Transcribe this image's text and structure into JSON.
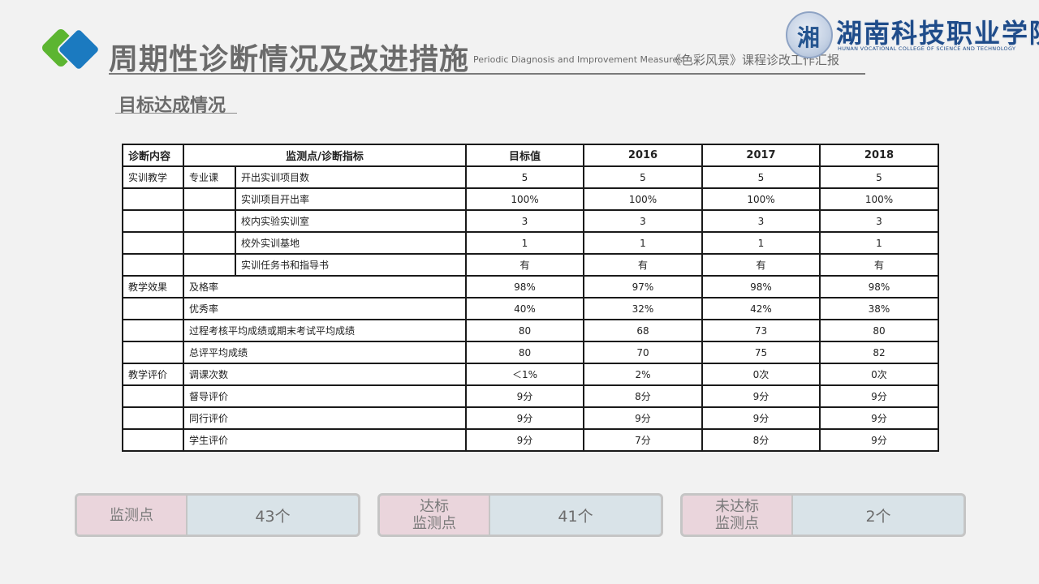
{
  "header": {
    "title": "周期性诊断情况及改进措施",
    "subtitle_en": "Periodic Diagnosis and Improvement Measures",
    "subtitle_cn": "《色彩风景》课程诊改工作汇报"
  },
  "school": {
    "name_cn": "湖南科技职业学院",
    "name_en": "HUNAN VOCATIONAL COLLEGE OF SCIENCE AND TECHNOLOGY"
  },
  "section_title": "目标达成情况",
  "table": {
    "headers": [
      "诊断内容",
      "监测点/诊断指标",
      "目标值",
      "2016",
      "2017",
      "2018"
    ],
    "rows": [
      {
        "c1": "实训教学",
        "c2": "专业课",
        "c3": "开出实训项目数",
        "vals": [
          "5",
          "5",
          "5",
          "5"
        ]
      },
      {
        "c1": "",
        "c2": "",
        "c3": "实训项目开出率",
        "vals": [
          "100%",
          "100%",
          "100%",
          "100%"
        ]
      },
      {
        "c1": "",
        "c2": "",
        "c3": "校内实验实训室",
        "vals": [
          "3",
          "3",
          "3",
          "3"
        ]
      },
      {
        "c1": "",
        "c2": "",
        "c3": "校外实训基地",
        "vals": [
          "1",
          "1",
          "1",
          "1"
        ]
      },
      {
        "c1": "",
        "c2": "",
        "c3": "实训任务书和指导书",
        "vals": [
          "有",
          "有",
          "有",
          "有"
        ]
      },
      {
        "c1": "教学效果",
        "c2": "及格率",
        "vals": [
          "98%",
          "97%",
          "98%",
          "98%"
        ]
      },
      {
        "c1": "",
        "c2": "优秀率",
        "vals": [
          "40%",
          "32%",
          "42%",
          "38%"
        ]
      },
      {
        "c1": "",
        "c2": "过程考核平均成绩或期末考试平均成绩",
        "vals": [
          "80",
          "68",
          "73",
          "80"
        ]
      },
      {
        "c1": "",
        "c2": "总评平均成绩",
        "vals": [
          "80",
          "70",
          "75",
          "82"
        ]
      },
      {
        "c1": "教学评价",
        "c2": "调课次数",
        "vals": [
          "＜1%",
          "2%",
          "0次",
          "0次"
        ]
      },
      {
        "c1": "",
        "c2": "督导评价",
        "vals": [
          "9分",
          "8分",
          "9分",
          "9分"
        ]
      },
      {
        "c1": "",
        "c2": "同行评价",
        "vals": [
          "9分",
          "9分",
          "9分",
          "9分"
        ]
      },
      {
        "c1": "",
        "c2": "学生评价",
        "vals": [
          "9分",
          "7分",
          "8分",
          "9分"
        ]
      }
    ]
  },
  "summary": [
    {
      "label": "监测点",
      "value": "43个"
    },
    {
      "label": "达标监测点",
      "label_l1": "达标",
      "label_l2": "监测点",
      "value": "41个"
    },
    {
      "label": "未达标监测点",
      "label_l1": "未达标",
      "label_l2": "监测点",
      "value": "2个"
    }
  ],
  "colors": {
    "highlight_red": "#c0262b",
    "logo_green": "#5cb531",
    "logo_blue": "#1b7ac0",
    "summary_label_bg": "#ead5dc",
    "summary_value_bg": "#d9e3e8"
  }
}
